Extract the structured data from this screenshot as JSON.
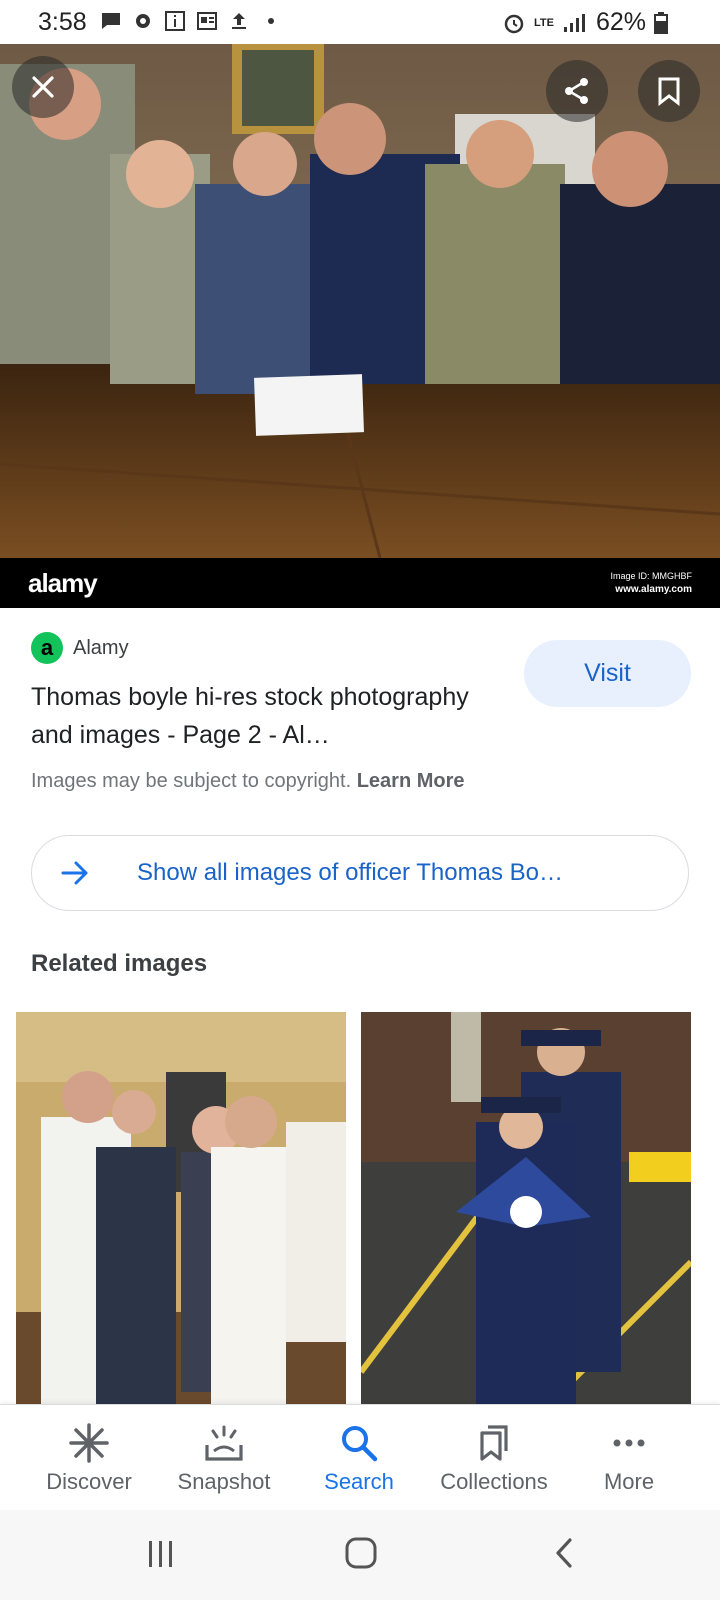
{
  "status_bar": {
    "time": "3:58",
    "battery": "62%",
    "network": "LTE"
  },
  "hero_image": {
    "watermark_logo": "alamy",
    "image_id": "Image ID: MMGHBF",
    "url": "www.alamy.com"
  },
  "result": {
    "source_icon_letter": "a",
    "source_name": "Alamy",
    "title": "Thomas boyle hi-res stock photography and images - Page 2 - Al…",
    "visit_label": "Visit",
    "copyright_text": "Images may be subject to copyright.",
    "learn_more": "Learn More"
  },
  "show_all": {
    "label": "Show all images of officer Thomas Bo…"
  },
  "related": {
    "title": "Related images"
  },
  "bottom_nav": {
    "items": [
      {
        "label": "Discover",
        "icon": "asterisk-icon"
      },
      {
        "label": "Snapshot",
        "icon": "snapshot-icon"
      },
      {
        "label": "Search",
        "icon": "search-icon"
      },
      {
        "label": "Collections",
        "icon": "collections-icon"
      },
      {
        "label": "More",
        "icon": "more-icon"
      }
    ],
    "active": "Search"
  },
  "colors": {
    "accent": "#1a73e8",
    "visit_bg": "#e8f0fe",
    "favicon": "#12c25a"
  }
}
